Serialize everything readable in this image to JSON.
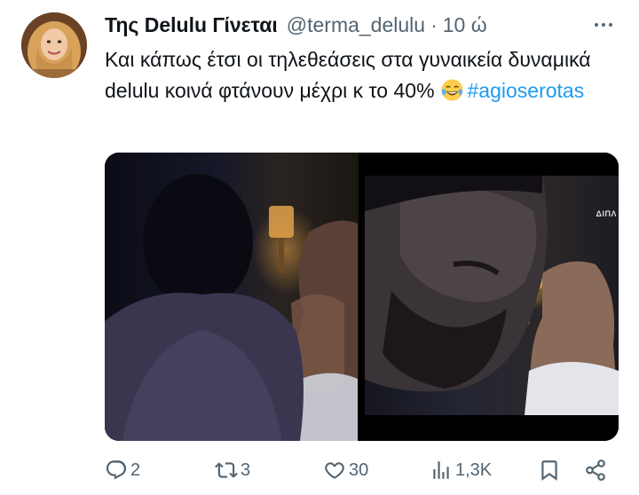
{
  "tweet": {
    "display_name": "Της Delulu Γίνεται",
    "handle": "@terma_delulu",
    "separator": "·",
    "time": "10 ώ",
    "text_main": "Και κάπως έτσι οι τηλεθεάσεις στα γυναικεία δυναμικά delulu κοινά φτάνουν μέχρι κ το 40%",
    "emoji": "face-with-tears-of-joy",
    "hashtag": "#agioserotas"
  },
  "media": {
    "watermark": "ΔΙΠΛ"
  },
  "actions": {
    "replies": "2",
    "reposts": "3",
    "likes": "30",
    "views": "1,3K"
  },
  "colors": {
    "text": "#0f1419",
    "secondary": "#536471",
    "link": "#1d9bf0"
  }
}
